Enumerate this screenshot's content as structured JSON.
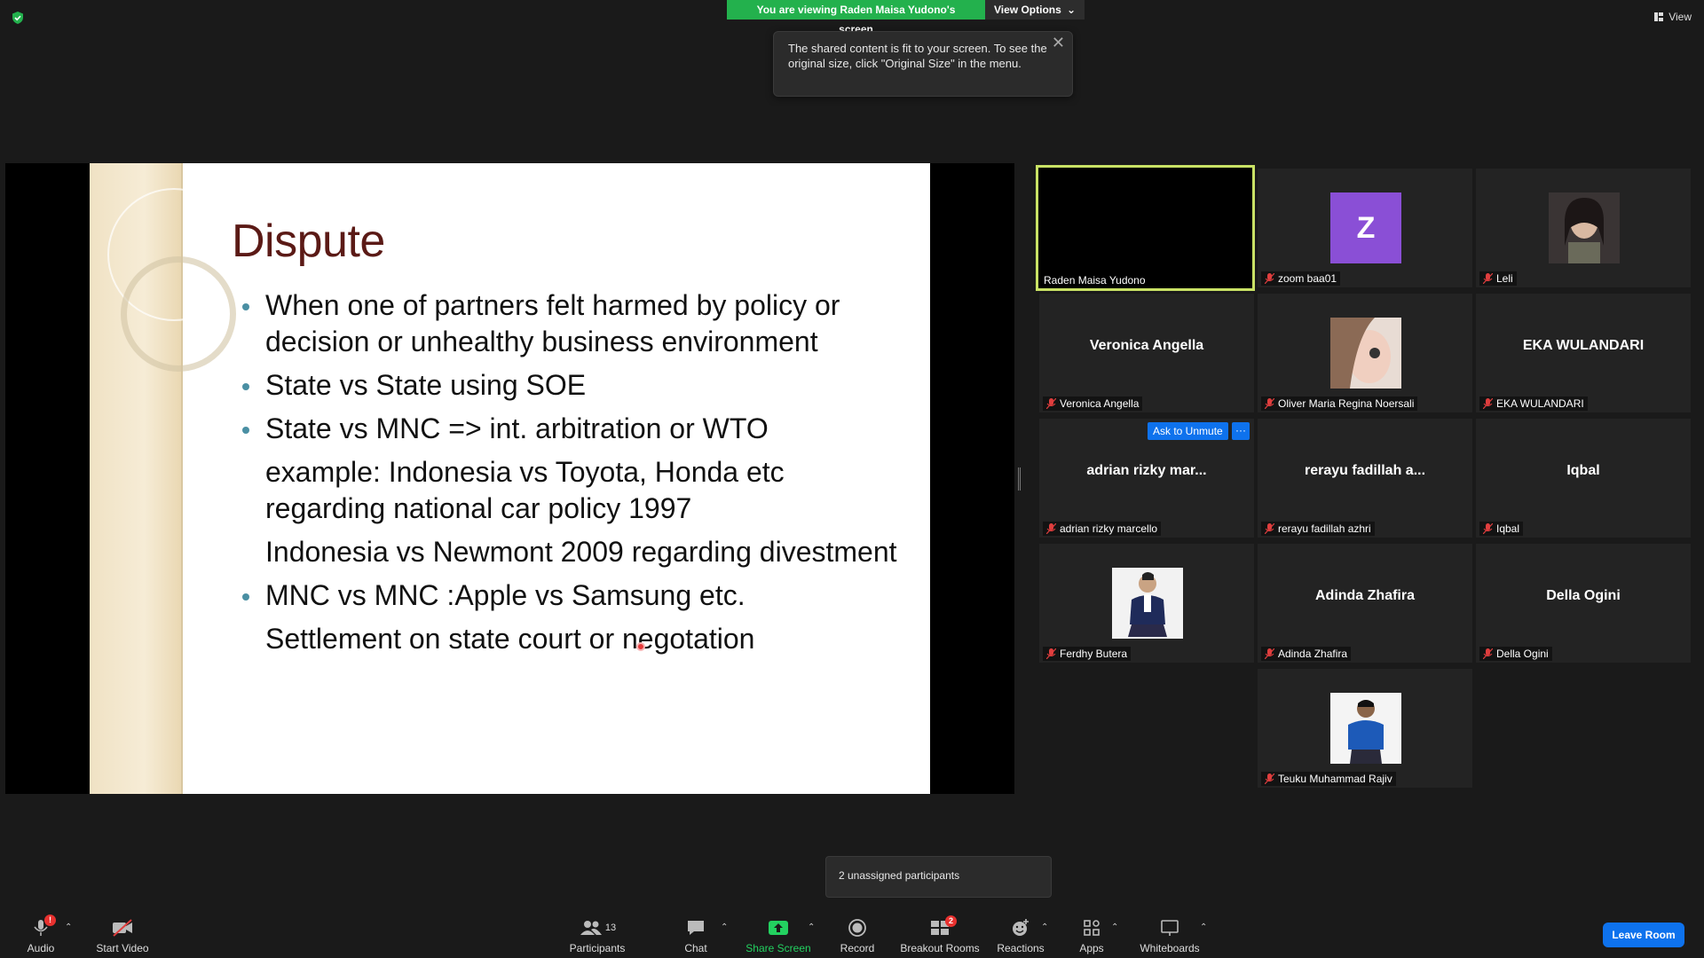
{
  "top": {
    "share_banner": "You are viewing Raden Maisa Yudono's screen",
    "view_options": "View Options",
    "tooltip_text": "The shared content is fit to your screen. To see the original size, click \"Original Size\" in the menu.",
    "view_label": "View"
  },
  "slide": {
    "title": "Dispute",
    "b1": "When one of partners felt harmed by policy or decision or unhealthy business environment",
    "b2": "State vs State using SOE",
    "b3": "State vs MNC => int. arbitration or WTO",
    "p1": "example: Indonesia vs Toyota, Honda etc regarding national car policy 1997",
    "p2": "Indonesia vs Newmont 2009 regarding divestment",
    "b4": "MNC vs MNC :Apple vs Samsung etc.",
    "p3": "Settlement on state court or negotation"
  },
  "gallery": {
    "t1": "Raden Maisa Yudono",
    "t2": "zoom baa01",
    "t2_letter": "Z",
    "t3": "Leli",
    "t4_big": "Veronica Angella",
    "t4": "Veronica Angella",
    "t5": "Oliver Maria Regina Noersali",
    "t6_big": "EKA WULANDARI",
    "t6": "EKA WULANDARI",
    "t7_big": "adrian rizky mar...",
    "t7": "adrian rizky marcello",
    "t8_big": "rerayu fadillah a...",
    "t8": "rerayu fadillah azhri",
    "t9_big": "Iqbal",
    "t9": "Iqbal",
    "t10": "Ferdhy Butera",
    "t11_big": "Adinda Zhafira",
    "t11": "Adinda Zhafira",
    "t12_big": "Della Ogini",
    "t12": "Della Ogini",
    "t13": "Teuku Muhammad Rajiv",
    "ask_unmute": "Ask to Unmute",
    "more": "···",
    "avatar_color": "#8a4fd6"
  },
  "unassigned": "2 unassigned participants",
  "toolbar": {
    "audio": "Audio",
    "audio_badge": "!",
    "video": "Start Video",
    "participants": "Participants",
    "participants_count": "13",
    "chat": "Chat",
    "share": "Share Screen",
    "record": "Record",
    "breakout": "Breakout Rooms",
    "breakout_badge": "2",
    "reactions": "Reactions",
    "apps": "Apps",
    "whiteboards": "Whiteboards",
    "leave": "Leave Room",
    "share_color": "#23d160",
    "leave_color": "#0e72ed"
  }
}
